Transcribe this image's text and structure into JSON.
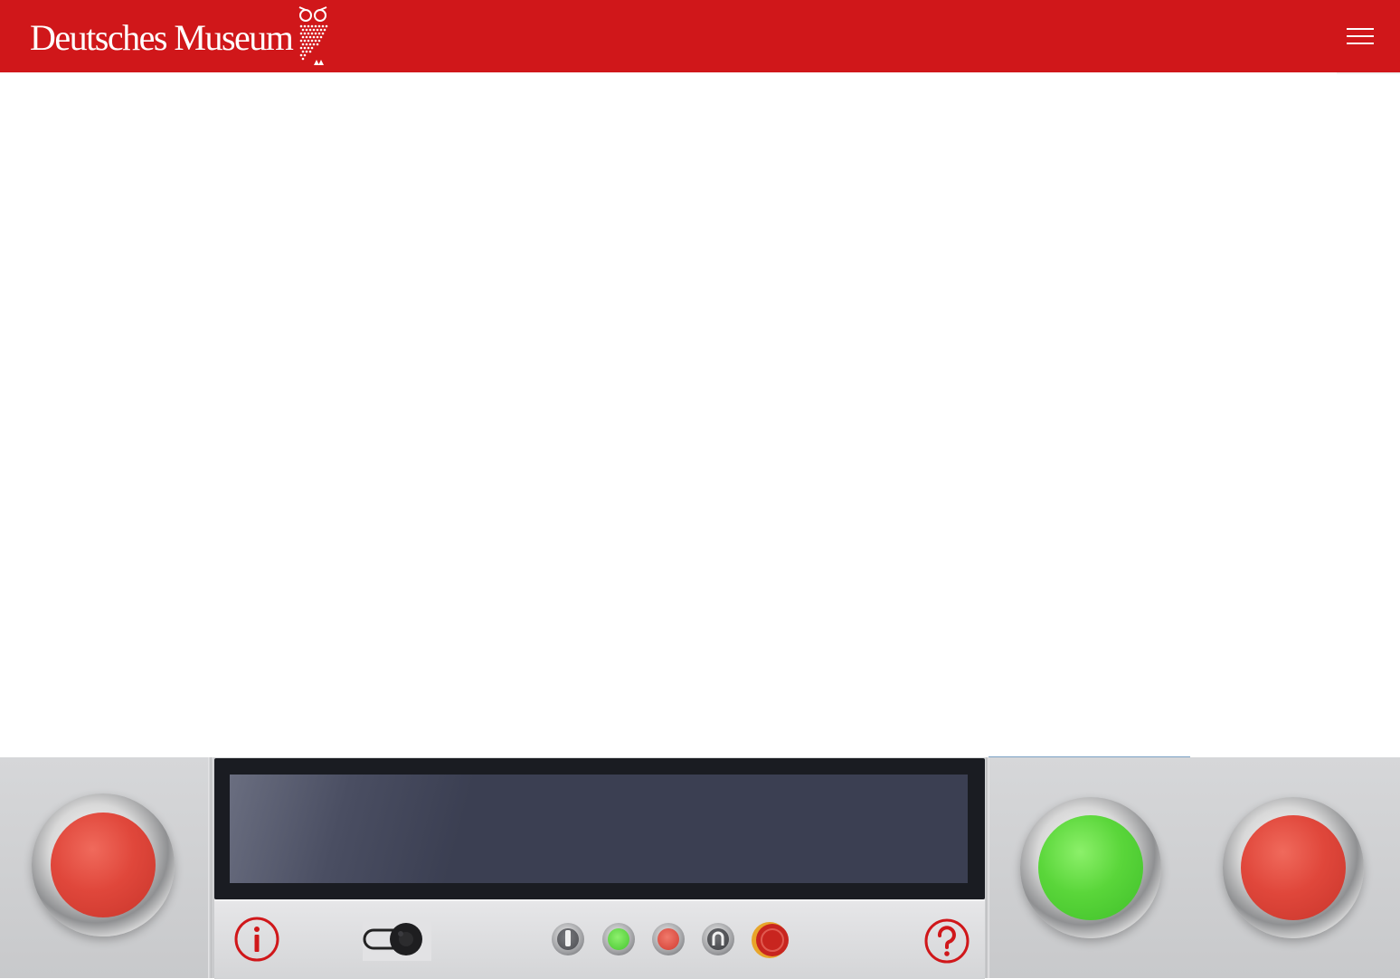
{
  "header": {
    "brand": "Deutsches Museum",
    "background_color": "#d0171a",
    "logo_icon": "owl-icon",
    "menu_icon": "hamburger-menu-icon"
  },
  "control_panel": {
    "display_screen": "",
    "left_button": {
      "color": "red",
      "icon": "red-push-button"
    },
    "right_buttons": [
      {
        "color": "green",
        "icon": "green-push-button"
      },
      {
        "color": "red",
        "icon": "red-push-button"
      }
    ],
    "bar_controls": [
      {
        "name": "info-icon"
      },
      {
        "name": "key-switch-icon"
      },
      {
        "name": "selector-switch-icon"
      },
      {
        "name": "green-indicator-button"
      },
      {
        "name": "red-indicator-button"
      },
      {
        "name": "key-lock-switch-icon"
      },
      {
        "name": "emergency-stop-button"
      },
      {
        "name": "help-icon"
      }
    ],
    "accent_red": "#d0171a",
    "accent_green": "#5ad63a"
  }
}
